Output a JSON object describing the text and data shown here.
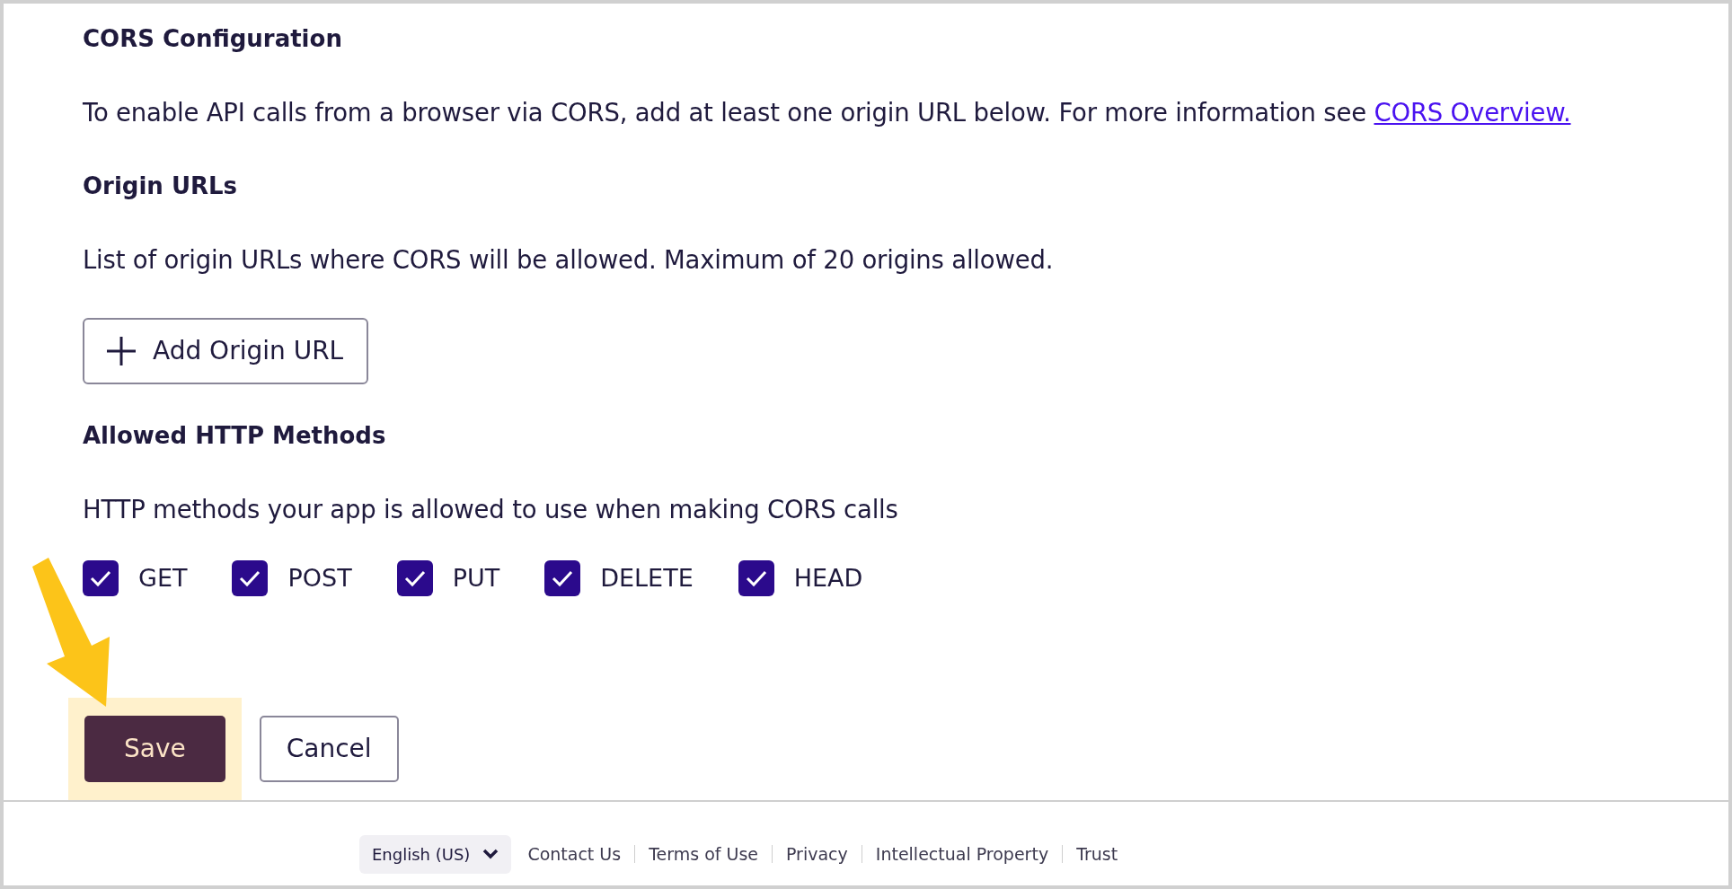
{
  "sections": [
    {
      "kind": "heading",
      "text": "CORS Configuration"
    },
    {
      "kind": "paragraph",
      "text": "To enable API calls from a browser via CORS, add at least one origin URL below. For more information see ",
      "link": "CORS Overview."
    },
    {
      "kind": "heading",
      "text": "Origin URLs"
    },
    {
      "kind": "paragraph",
      "text": "List of origin URLs where CORS will be allowed. Maximum of 20 origins allowed."
    },
    {
      "kind": "button",
      "text": "Add Origin URL"
    },
    {
      "kind": "heading",
      "text": "Allowed HTTP Methods"
    },
    {
      "kind": "paragraph",
      "text": "HTTP methods your app is allowed to use when making CORS calls"
    },
    {
      "kind": "checkboxes",
      "items": [
        {
          "label": "GET",
          "checked": true
        },
        {
          "label": "POST",
          "checked": true
        },
        {
          "label": "PUT",
          "checked": true
        },
        {
          "label": "DELETE",
          "checked": true
        },
        {
          "label": "HEAD",
          "checked": true
        }
      ]
    }
  ],
  "actions": [
    {
      "label": "Save",
      "kind": "primary",
      "highlighted": true
    },
    {
      "label": "Cancel",
      "kind": "secondary",
      "highlighted": false
    }
  ],
  "footer": {
    "language": "English (US)",
    "links": [
      "Contact Us",
      "Terms of Use",
      "Privacy",
      "Intellectual Property",
      "Trust"
    ]
  }
}
